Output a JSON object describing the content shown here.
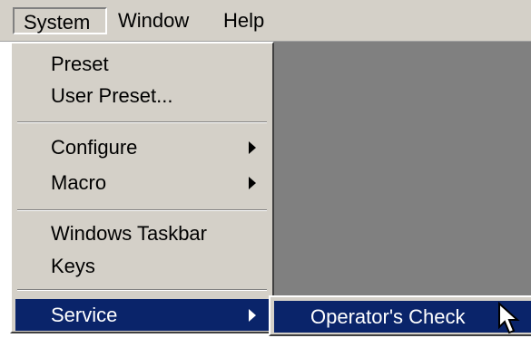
{
  "menubar": {
    "items": [
      {
        "label": "System"
      },
      {
        "label": "Window"
      },
      {
        "label": "Help"
      }
    ]
  },
  "system_menu": {
    "groups": [
      [
        {
          "label": "Preset"
        },
        {
          "label": "User Preset..."
        }
      ],
      [
        {
          "label": "Configure",
          "has_submenu": true
        },
        {
          "label": "Macro",
          "has_submenu": true
        }
      ],
      [
        {
          "label": "Windows Taskbar"
        },
        {
          "label": "Keys"
        }
      ],
      [
        {
          "label": "Service",
          "has_submenu": true,
          "highlighted": true
        }
      ]
    ]
  },
  "service_submenu": {
    "items": [
      {
        "label": "Operator's Check",
        "highlighted": true
      }
    ]
  },
  "colors": {
    "menu_face": "#d4d0c8",
    "highlight": "#0a246a",
    "workspace": "#808080"
  },
  "icons": {
    "submenu_arrow": "triangle-right",
    "cursor": "arrow-pointer"
  }
}
